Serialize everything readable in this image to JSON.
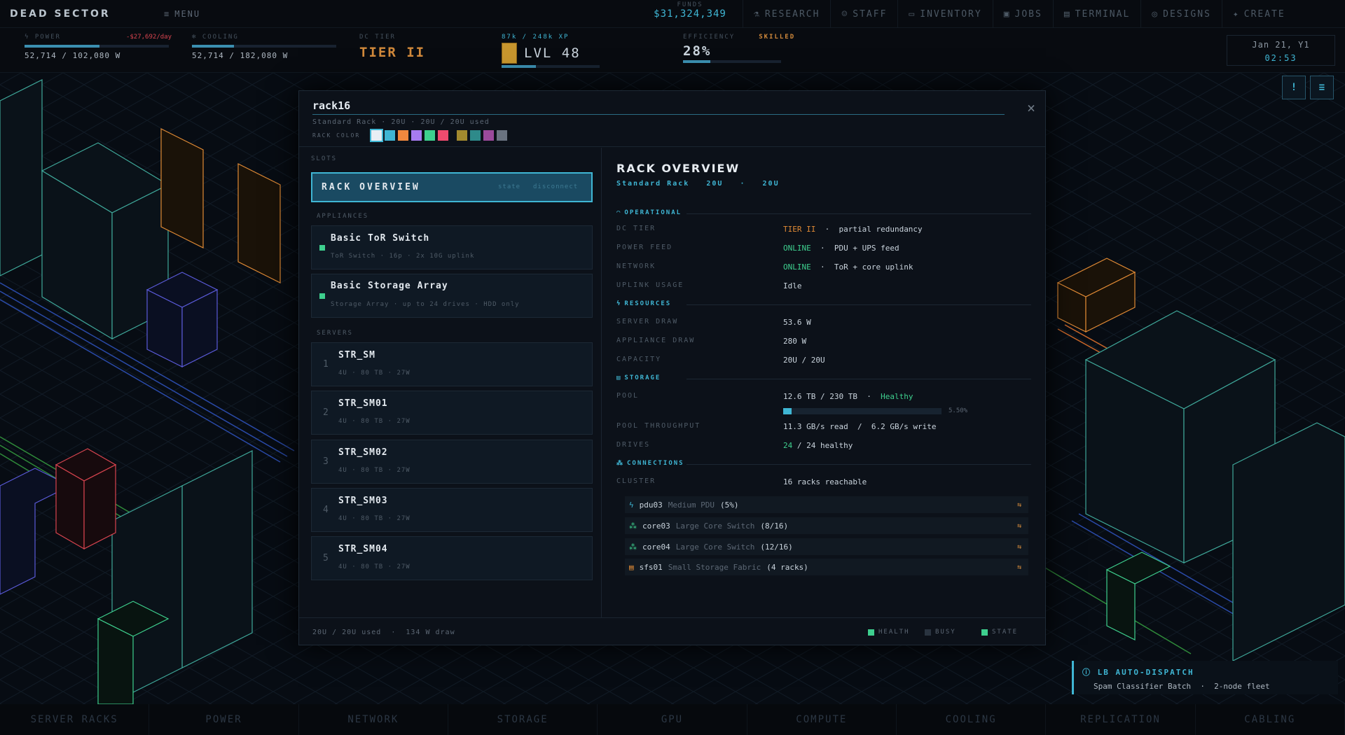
{
  "app": {
    "title": "DEAD SECTOR",
    "menu_label": "MENU"
  },
  "funds": {
    "label": "FUNDS",
    "value": "$31,324,349"
  },
  "nav": [
    "RESEARCH",
    "STAFF",
    "INVENTORY",
    "JOBS",
    "TERMINAL",
    "DESIGNS",
    "CREATE"
  ],
  "stats": {
    "power": {
      "label": "POWER",
      "rate": "-$27,692/day",
      "value": "52,714 / 102,080 W",
      "fill": 0.52
    },
    "cooling": {
      "label": "COOLING",
      "value": "52,714 / 182,080 W",
      "fill": 0.29
    },
    "tier": {
      "label": "DC TIER",
      "value": "TIER II"
    },
    "level": {
      "xp": "87k / 248k XP",
      "value": "LVL 48",
      "fill": 0.35
    },
    "efficiency": {
      "label": "EFFICIENCY",
      "value": "28%",
      "rank": "SKILLED",
      "fill": 0.28
    },
    "date": "Jan 21, Y1",
    "time": "02:53"
  },
  "modal": {
    "name": "rack16",
    "sub": "Standard Rack · 20U · 20U / 20U used",
    "color_label": "RACK COLOR",
    "swatches": [
      "#e8eef4",
      "#3fb6d4",
      "#f0883e",
      "#a77bf0",
      "#3ecf8e",
      "#ef4b6e",
      "#a38a2e",
      "#2e8a8a",
      "#9b4a9b",
      "#6a7380"
    ],
    "slots_label": "SLOTS",
    "overview": {
      "label": "RACK OVERVIEW",
      "state": "state",
      "disconnect": "disconnect"
    },
    "appliances_label": "APPLIANCES",
    "appliances": [
      {
        "name": "Basic ToR Switch",
        "meta": "ToR Switch · 16p · 2x 10G uplink"
      },
      {
        "name": "Basic Storage Array",
        "meta": "Storage Array · up to 24 drives · HDD only"
      }
    ],
    "servers_label": "SERVERS",
    "servers": [
      {
        "num": "1",
        "name": "STR_SM",
        "meta": "4U · 80 TB · 27W"
      },
      {
        "num": "2",
        "name": "STR_SM01",
        "meta": "4U · 80 TB · 27W"
      },
      {
        "num": "3",
        "name": "STR_SM02",
        "meta": "4U · 80 TB · 27W"
      },
      {
        "num": "4",
        "name": "STR_SM03",
        "meta": "4U · 80 TB · 27W"
      },
      {
        "num": "5",
        "name": "STR_SM04",
        "meta": "4U · 80 TB · 27W"
      }
    ],
    "right": {
      "title": "RACK OVERVIEW",
      "sub": "Standard Rack   20U   ·   20U",
      "operational": "OPERATIONAL",
      "rows_op": [
        {
          "k": "DC TIER",
          "v1": "TIER II",
          "v2": "  ·  partial redundancy"
        },
        {
          "k": "POWER FEED",
          "v1": "ONLINE",
          "v2": "  ·  PDU + UPS feed"
        },
        {
          "k": "NETWORK",
          "v1": "ONLINE",
          "v2": "  ·  ToR + core uplink"
        },
        {
          "k": "UPLINK USAGE",
          "v1": "",
          "v2": "Idle"
        }
      ],
      "resources": "RESOURCES",
      "rows_res": [
        {
          "k": "SERVER DRAW",
          "v": "53.6 W"
        },
        {
          "k": "APPLIANCE DRAW",
          "v": "280 W"
        },
        {
          "k": "CAPACITY",
          "v": "20U / 20U"
        }
      ],
      "storage": "STORAGE",
      "pool": {
        "k": "POOL",
        "v": "12.6 TB / 230 TB  ·  ",
        "status": "Healthy",
        "pct": "5.50%",
        "fill": 0.055
      },
      "throughput": {
        "k": "POOL THROUGHPUT",
        "v": "11.3 GB/s read  /  6.2 GB/s write"
      },
      "drives": {
        "k": "DRIVES",
        "n": "24",
        "v": " / 24 healthy"
      },
      "connections": "CONNECTIONS",
      "cluster": {
        "k": "CLUSTER",
        "v": "16 racks reachable"
      },
      "links": [
        {
          "icon": "bolt-icon",
          "id": "pdu03",
          "type": "Medium PDU",
          "extra": "(5%)"
        },
        {
          "icon": "network-icon",
          "id": "core03",
          "type": "Large Core Switch",
          "extra": "(8/16)"
        },
        {
          "icon": "network-icon",
          "id": "core04",
          "type": "Large Core Switch",
          "extra": "(12/16)"
        },
        {
          "icon": "storage-icon",
          "id": "sfs01",
          "type": "Small Storage Fabric",
          "extra": "(4 racks)"
        }
      ],
      "link_symbol": "⇆"
    },
    "footer": {
      "summary": "20U / 20U used  ·  134 W draw",
      "legend": [
        "HEALTH",
        "BUSY",
        "STATE"
      ]
    }
  },
  "toast": {
    "title": "LB AUTO-DISPATCH",
    "body": "Spam Classifier Batch  ·  2-node fleet"
  },
  "bottom_tabs": [
    "SERVER RACKS",
    "POWER",
    "NETWORK",
    "STORAGE",
    "GPU",
    "COMPUTE",
    "COOLING",
    "REPLICATION",
    "CABLING"
  ],
  "colors": {
    "accent": "#3fb6d4",
    "warn": "#e08a35",
    "ok": "#3ecf8e"
  }
}
